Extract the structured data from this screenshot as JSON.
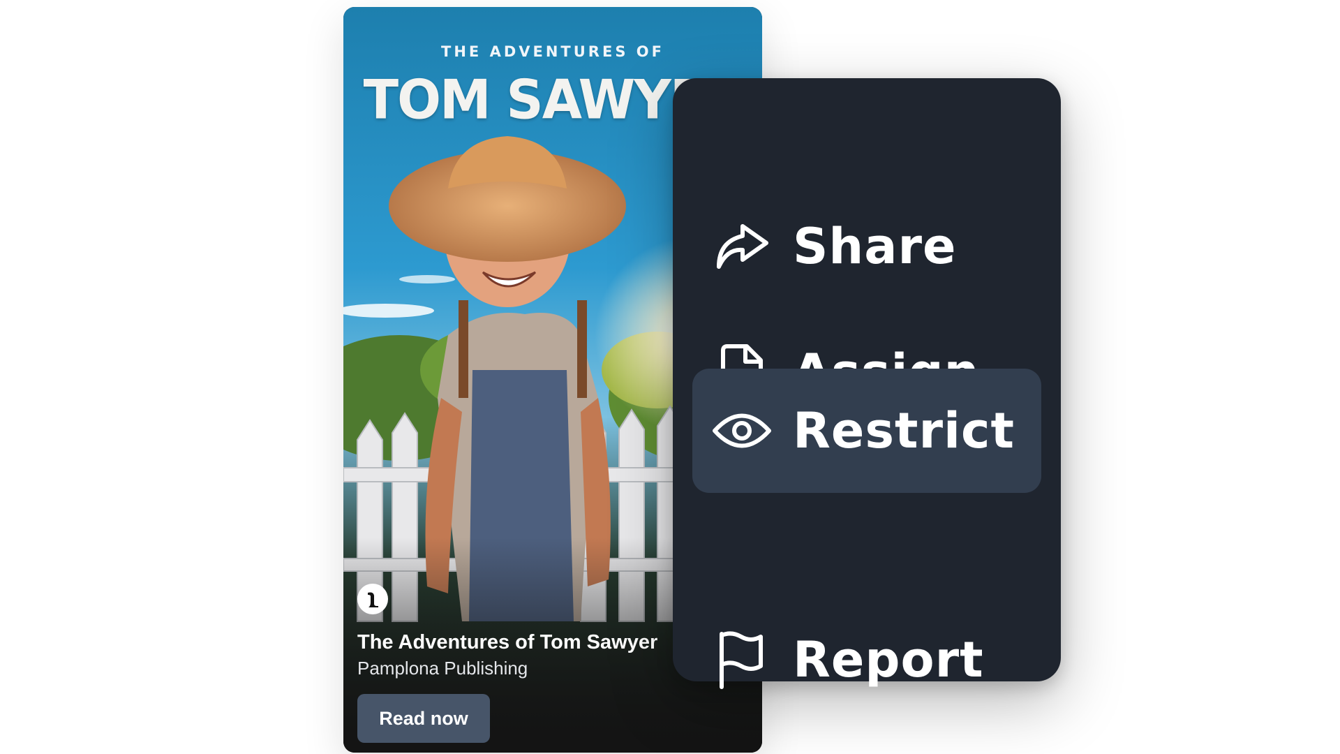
{
  "book": {
    "cover_kicker": "THE ADVENTURES OF",
    "cover_title": "TOM SAWYER",
    "title": "The Adventures of Tom Sawyer",
    "publisher": "Pamplona Publishing",
    "read_label": "Read now"
  },
  "menu": {
    "items": [
      {
        "label": "Share",
        "icon": "share-arrow-icon"
      },
      {
        "label": "Assign",
        "icon": "file-plus-icon"
      },
      {
        "label": "Restrict",
        "icon": "eye-icon",
        "active": true
      },
      {
        "label": "Report",
        "icon": "flag-icon"
      }
    ]
  },
  "colors": {
    "menu_bg": "#1f252f",
    "menu_active_bg": "#323e4f",
    "button_bg": "#475569",
    "card_bottom": "#141414"
  }
}
